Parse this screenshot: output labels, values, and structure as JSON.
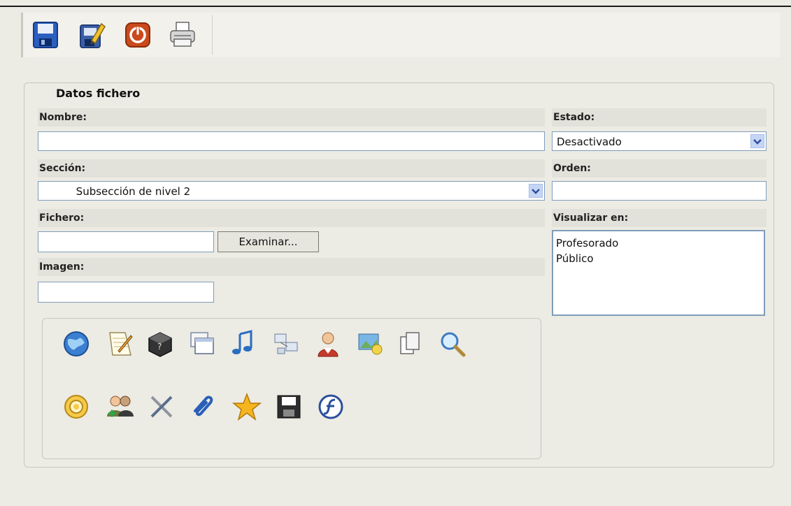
{
  "toolbar": {
    "buttons": [
      {
        "icon": "floppy-save-icon"
      },
      {
        "icon": "edit-document-icon"
      },
      {
        "icon": "power-exit-icon"
      },
      {
        "icon": "printer-icon"
      }
    ]
  },
  "form": {
    "legend": "Datos fichero",
    "nombre_label": "Nombre:",
    "nombre_value": "",
    "estado_label": "Estado:",
    "estado_value": "Desactivado",
    "seccion_label": "Sección:",
    "seccion_value": "          Subsección de nivel 2",
    "orden_label": "Orden:",
    "orden_value": "",
    "fichero_label": "Fichero:",
    "fichero_value": "",
    "browse_label": "Examinar...",
    "imagen_label": "Imagen:",
    "imagen_value": "",
    "visualizar_label": "Visualizar en:",
    "visualizar_options": [
      "Profesorado",
      "Público"
    ]
  },
  "icons": [
    "globe-icon",
    "notepad-icon",
    "help-cube-icon",
    "windows-icon",
    "music-note-icon",
    "network-icon",
    "user-icon",
    "image-edit-icon",
    "copy-pages-icon",
    "search-icon",
    "gear-icon",
    "add-users-icon",
    "tools-icon",
    "paperclip-icon",
    "star-icon",
    "floppy-icon",
    "flash-icon"
  ],
  "colors": {
    "background": "#ecebe4",
    "label_bar": "#e2e1da",
    "input_border": "#7f9db9",
    "select_button": "#c5d5f6"
  }
}
